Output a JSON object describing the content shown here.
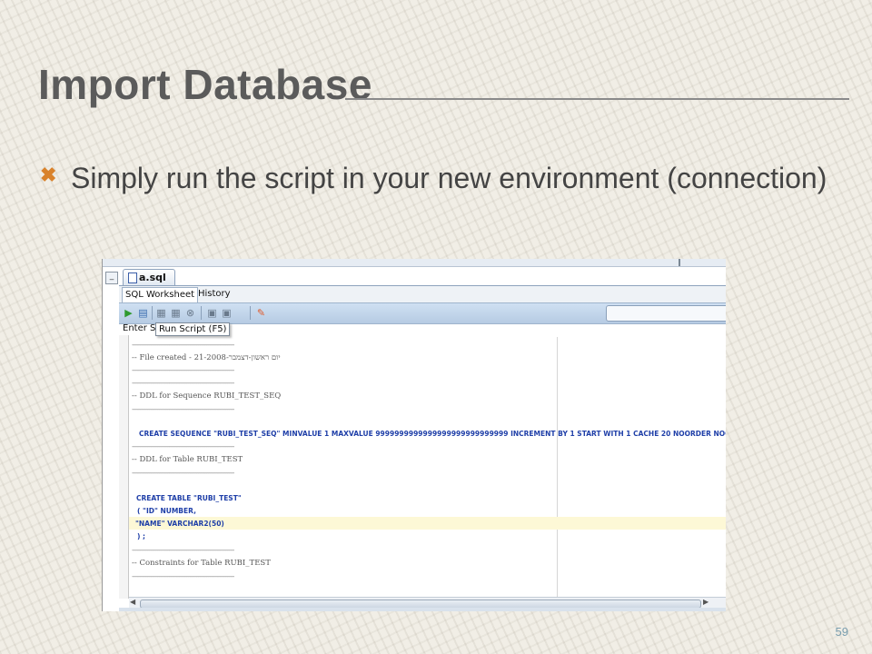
{
  "slide": {
    "title": "Import Database",
    "bullet": "Simply run the script in your new environment (connection)",
    "page_number": "59"
  },
  "screenshot": {
    "tab_title": "a.sql",
    "subtabs": [
      "SQL Worksheet",
      "History"
    ],
    "enter_label": "Enter S",
    "tooltip": "Run Script (F5)",
    "code_lines": [
      "-- File created - יום ראשון-דצמבר-21-2008",
      "-- DDL for Sequence RUBI_TEST_SEQ",
      "CREATE SEQUENCE  \"RUBI_TEST_SEQ\"  MINVALUE 1 MAXVALUE 9999999999999999999999999999 INCREMENT BY 1 START WITH 1 CACHE 20 NOORDER  NOCY",
      "-- DDL for Table RUBI_TEST",
      "CREATE TABLE \"RUBI_TEST\"",
      "( \"ID\" NUMBER,",
      "\"NAME\" VARCHAR2(50)",
      ") ;",
      "-- Constraints for Table RUBI_TEST"
    ]
  }
}
